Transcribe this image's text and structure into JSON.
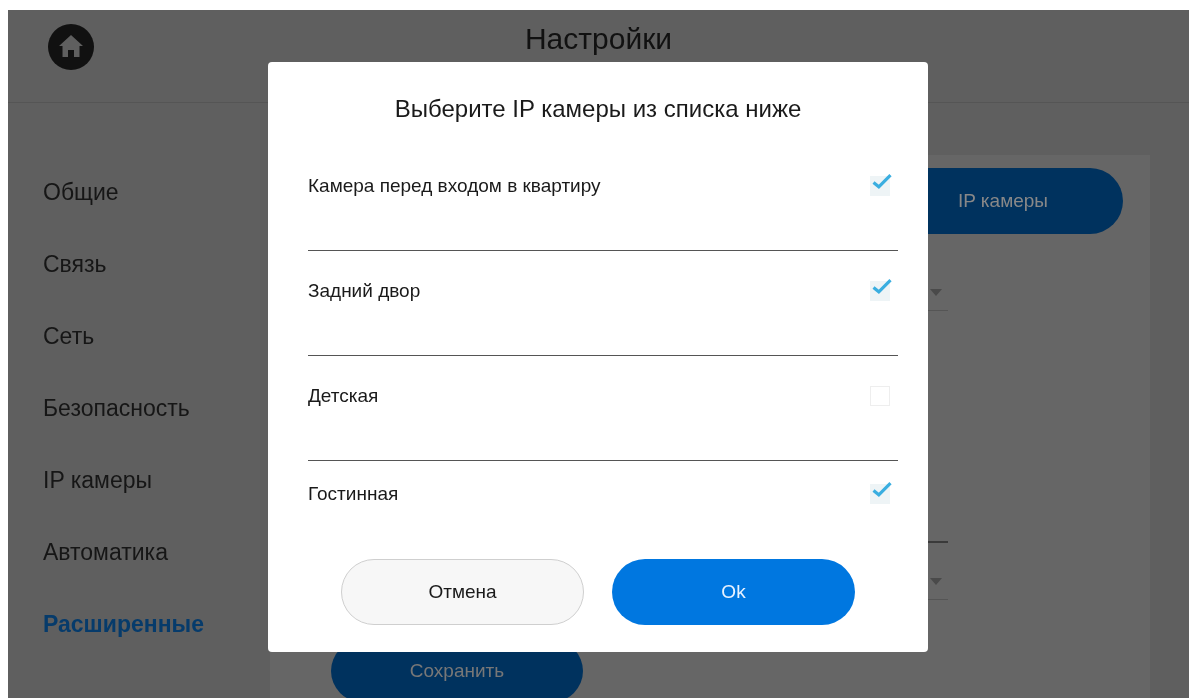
{
  "screen": {
    "title": "Настройки",
    "sidebar": {
      "items": [
        {
          "label": "Общие",
          "selected": false
        },
        {
          "label": "Связь",
          "selected": false
        },
        {
          "label": "Сеть",
          "selected": false
        },
        {
          "label": "Безопасность",
          "selected": false
        },
        {
          "label": "IP камеры",
          "selected": false
        },
        {
          "label": "Автоматика",
          "selected": false
        },
        {
          "label": "Расширенные",
          "selected": true
        }
      ]
    },
    "content": {
      "tabs": [
        {
          "label": "IP камеры",
          "selected": true
        }
      ],
      "save_button": "Сохранить"
    }
  },
  "dialog": {
    "title": "Выберите IP камеры из списка ниже",
    "options": [
      {
        "label": "Камера перед входом в квартиру",
        "checked": true
      },
      {
        "label": "Задний двор",
        "checked": true
      },
      {
        "label": "Детская",
        "checked": false
      },
      {
        "label": "Гостинная",
        "checked": true
      }
    ],
    "buttons": [
      {
        "label": "Отмена",
        "kind": "secondary"
      },
      {
        "label": "Ok",
        "kind": "primary"
      }
    ]
  }
}
